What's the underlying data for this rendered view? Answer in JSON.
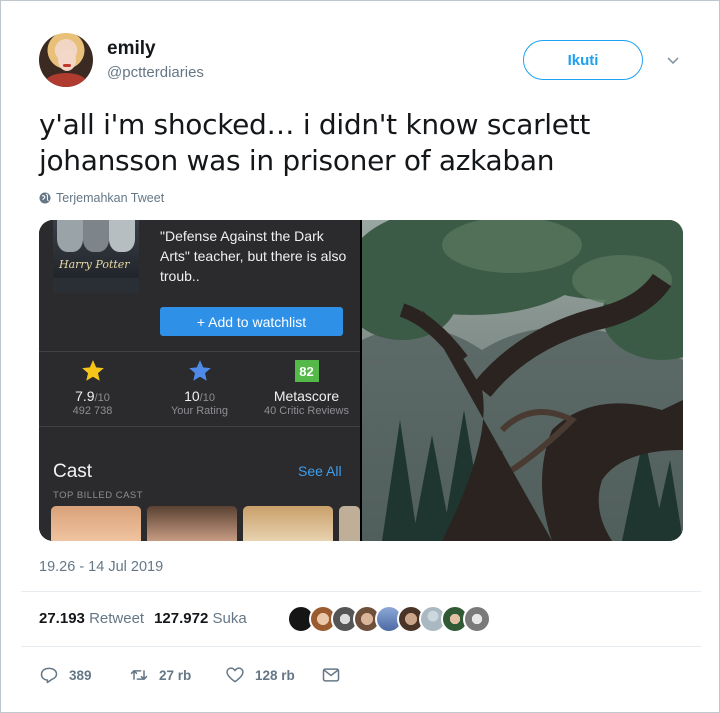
{
  "user": {
    "name": "emily",
    "handle": "@pctterdiaries"
  },
  "follow_label": "Ikuti",
  "tweet_text": "y'all i'm shocked… i didn't know scarlett johansson was in prisoner of azkaban",
  "translate_label": "Terjemahkan Tweet",
  "media": {
    "poster_title": "Harry Potter",
    "blurb": "\"Defense Against the Dark Arts\" teacher, but there is also troub..",
    "watchlist_label": "+ Add to watchlist",
    "ratings": [
      {
        "value": "7.9",
        "scale": "/10",
        "sub": "492 738"
      },
      {
        "value": "10",
        "scale": "/10",
        "sub": "Your Rating"
      },
      {
        "badge": "82",
        "value": "Metascore",
        "sub": "40 Critic Reviews"
      }
    ],
    "cast_title": "Cast",
    "see_all_label": "See All",
    "top_billed_label": "TOP BILLED CAST"
  },
  "timestamp": "19.26 - 14 Jul 2019",
  "stats": {
    "retweets": "27.193",
    "retweets_label": "Retweet",
    "likes": "127.972",
    "likes_label": "Suka"
  },
  "actions": {
    "replies": "389",
    "retweets": "27 rb",
    "likes": "128 rb"
  },
  "colors": {
    "accent": "#1da1f2",
    "muted": "#657786",
    "meta_green": "#54b948",
    "star_yellow": "#f5c518",
    "star_blue": "#4f8ae8"
  }
}
